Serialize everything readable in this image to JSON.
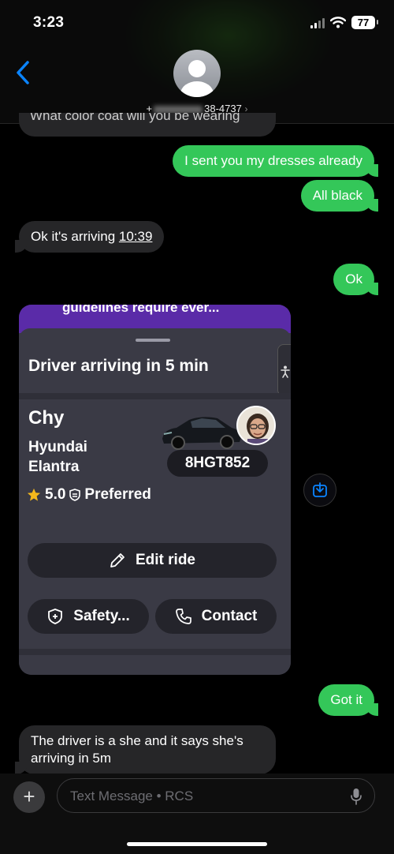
{
  "status_bar": {
    "time": "3:23",
    "battery": "77"
  },
  "header": {
    "number_prefix": "+",
    "number_suffix": "38-4737",
    "chevron": "›"
  },
  "messages": {
    "partial_top": "What color coat will you be wearing",
    "m1": "I sent you my dresses already",
    "m2": "All black",
    "m3_prefix": "Ok it's arriving ",
    "m3_time": "10:39",
    "m4": "Ok",
    "m5": "Got it",
    "m6": "The driver is a she and it says she's arriving in 5m"
  },
  "ride_card": {
    "banner_text": "guidelines require ever...",
    "status": "Driver arriving in 5 min",
    "driver_name": "Chy",
    "car_model": "Hyundai Elantra",
    "rating": "5.0",
    "badge": "Preferred",
    "plate": "8HGT852",
    "edit_label": "Edit ride",
    "safety_label": "Safety...",
    "contact_label": "Contact",
    "accessibility_icon": "accessibility-icon"
  },
  "composer": {
    "placeholder": "Text Message • RCS"
  },
  "colors": {
    "outgoing": "#34c759",
    "incoming": "#262628",
    "brand": "#5a2ba8",
    "link": "#0a84ff"
  }
}
